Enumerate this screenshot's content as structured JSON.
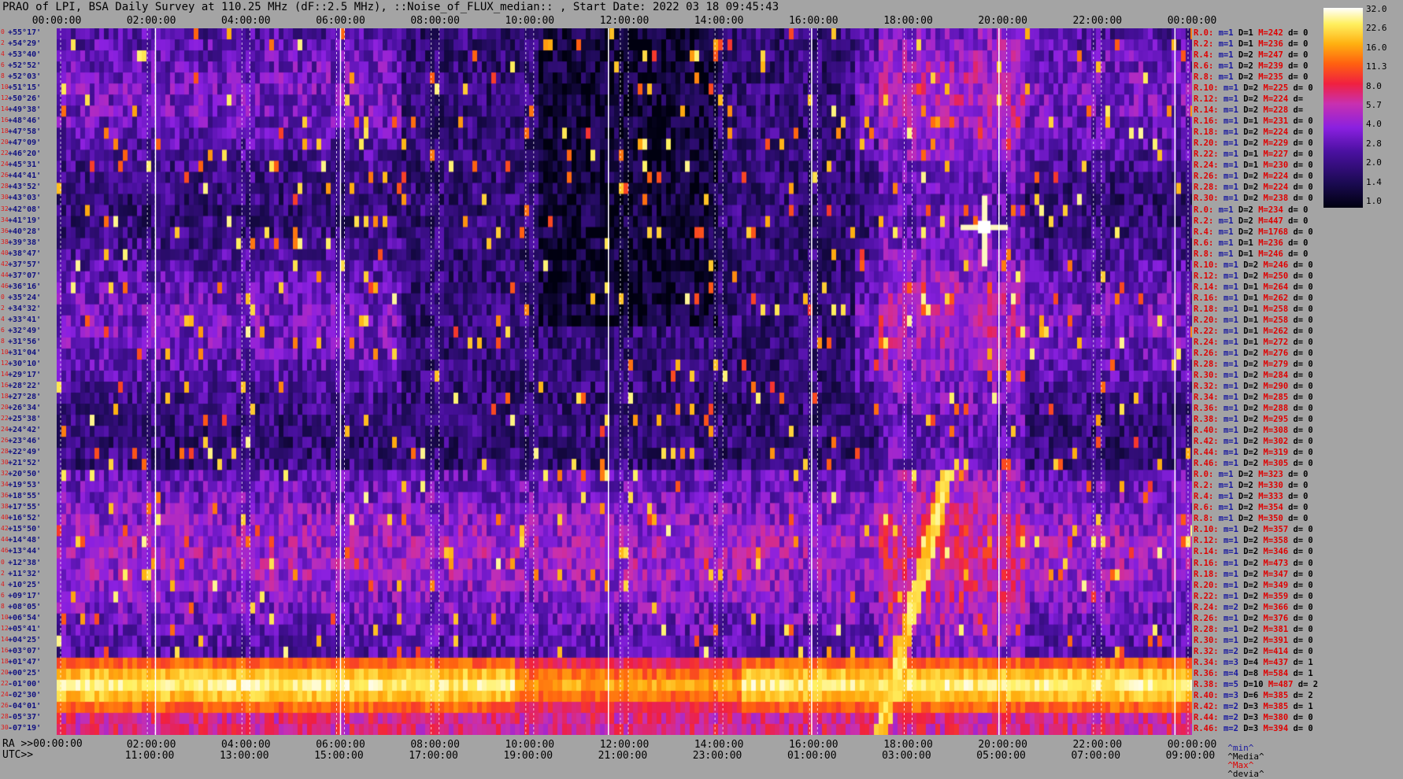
{
  "title": "PRAO of LPI, BSA Daily Survey at 110.25 MHz (dF::2.5 MHz), ::Noise_of_FLUX_median:: , Start Date: 2022 03 18 09:45:43",
  "top_ticks": [
    "00:00:00",
    "02:00:00",
    "04:00:00",
    "06:00:00",
    "08:00:00",
    "10:00:00",
    "12:00:00",
    "14:00:00",
    "16:00:00",
    "18:00:00",
    "20:00:00",
    "22:00:00",
    "00:00:00"
  ],
  "ra_label": "RA >>00:00:00",
  "ra_ticks": [
    "02:00:00",
    "04:00:00",
    "06:00:00",
    "08:00:00",
    "10:00:00",
    "12:00:00",
    "14:00:00",
    "16:00:00",
    "18:00:00",
    "20:00:00",
    "22:00:00",
    "00:00:00"
  ],
  "utc_label": "UTC>>",
  "utc_ticks": [
    "11:00:00",
    "13:00:00",
    "15:00:00",
    "17:00:00",
    "19:00:00",
    "21:00:00",
    "23:00:00",
    "01:00:00",
    "03:00:00",
    "05:00:00",
    "07:00:00",
    "09:00:00"
  ],
  "beam_numbers": [
    "0",
    "2",
    "4",
    "6",
    "8",
    "10",
    "12",
    "14",
    "16",
    "18",
    "20",
    "22",
    "24",
    "26",
    "28",
    "30",
    "32",
    "34",
    "36",
    "38",
    "40",
    "42",
    "44",
    "46",
    "0",
    "2",
    "4",
    "6",
    "8",
    "10",
    "12",
    "14",
    "16",
    "18",
    "20",
    "22",
    "24",
    "26",
    "28",
    "30",
    "32",
    "34",
    "36",
    "38",
    "40",
    "42",
    "44",
    "46",
    "0",
    "2",
    "4",
    "6",
    "8",
    "10",
    "12",
    "14",
    "16",
    "18",
    "20",
    "22",
    "24",
    "26",
    "28",
    "30",
    "32",
    "34",
    "36",
    "38",
    "40",
    "42",
    "44",
    "46"
  ],
  "declinations": [
    "+55°17'",
    "+54°29'",
    "+53°40'",
    "+52°52'",
    "+52°03'",
    "+51°15'",
    "+50°26'",
    "+49°38'",
    "+48°46'",
    "+47°58'",
    "+47°09'",
    "+46°20'",
    "+45°31'",
    "+44°41'",
    "+43°52'",
    "+43°03'",
    "+42°08'",
    "+41°19'",
    "+40°28'",
    "+39°38'",
    "+38°47'",
    "+37°57'",
    "+37°07'",
    "+36°16'",
    "+35°24'",
    "+34°32'",
    "+33°41'",
    "+32°49'",
    "+31°56'",
    "+31°04'",
    "+30°10'",
    "+29°17'",
    "+28°22'",
    "+27°28'",
    "+26°34'",
    "+25°38'",
    "+24°42'",
    "+23°46'",
    "+22°49'",
    "+21°52'",
    "+20°50'",
    "+19°53'",
    "+18°55'",
    "+17°55'",
    "+16°52'",
    "+15°50'",
    "+14°48'",
    "+13°44'",
    "+12°38'",
    "+11°32'",
    "+10°25'",
    "+09°17'",
    "+08°05'",
    "+06°54'",
    "+05°41'",
    "+04°25'",
    "+03°07'",
    "+01°47'",
    "+00°25'",
    "-01°00'",
    "-02°30'",
    "-04°01'",
    "-05°37'",
    "-07°19'"
  ],
  "stats": [
    {
      "r": "R.0:",
      "m": "m=1",
      "D": "D=1",
      "M": "M=242",
      "d": "d= 0"
    },
    {
      "r": "R.2:",
      "m": "m=1",
      "D": "D=1",
      "M": "M=236",
      "d": "d= 0"
    },
    {
      "r": "R.4:",
      "m": "m=1",
      "D": "D=2",
      "M": "M=247",
      "d": "d= 0"
    },
    {
      "r": "R.6:",
      "m": "m=1",
      "D": "D=2",
      "M": "M=239",
      "d": "d= 0"
    },
    {
      "r": "R.8:",
      "m": "m=1",
      "D": "D=2",
      "M": "M=235",
      "d": "d= 0"
    },
    {
      "r": "R.10:",
      "m": "m=1",
      "D": "D=2",
      "M": "M=225",
      "d": "d= 0"
    },
    {
      "r": "R.12:",
      "m": "m=1",
      "D": "D=2",
      "M": "M=224",
      "d": "d="
    },
    {
      "r": "R.14:",
      "m": "m=1",
      "D": "D=2",
      "M": "M=228",
      "d": "d="
    },
    {
      "r": "R.16:",
      "m": "m=1",
      "D": "D=1",
      "M": "M=231",
      "d": "d= 0"
    },
    {
      "r": "R.18:",
      "m": "m=1",
      "D": "D=2",
      "M": "M=224",
      "d": "d= 0"
    },
    {
      "r": "R.20:",
      "m": "m=1",
      "D": "D=2",
      "M": "M=229",
      "d": "d= 0"
    },
    {
      "r": "R.22:",
      "m": "m=1",
      "D": "D=1",
      "M": "M=227",
      "d": "d= 0"
    },
    {
      "r": "R.24:",
      "m": "m=1",
      "D": "D=1",
      "M": "M=230",
      "d": "d= 0"
    },
    {
      "r": "R.26:",
      "m": "m=1",
      "D": "D=2",
      "M": "M=224",
      "d": "d= 0"
    },
    {
      "r": "R.28:",
      "m": "m=1",
      "D": "D=2",
      "M": "M=224",
      "d": "d= 0"
    },
    {
      "r": "R.30:",
      "m": "m=1",
      "D": "D=2",
      "M": "M=238",
      "d": "d= 0"
    },
    {
      "r": "R.0:",
      "m": "m=1",
      "D": "D=2",
      "M": "M=234",
      "d": "d= 0"
    },
    {
      "r": "R.2:",
      "m": "m=1",
      "D": "D=2",
      "M": "M=447",
      "d": "d= 0"
    },
    {
      "r": "R.4:",
      "m": "m=1",
      "D": "D=2",
      "M": "M=1768",
      "d": "d= 0"
    },
    {
      "r": "R.6:",
      "m": "m=1",
      "D": "D=1",
      "M": "M=236",
      "d": "d= 0"
    },
    {
      "r": "R.8:",
      "m": "m=1",
      "D": "D=1",
      "M": "M=246",
      "d": "d= 0"
    },
    {
      "r": "R.10:",
      "m": "m=1",
      "D": "D=2",
      "M": "M=246",
      "d": "d= 0"
    },
    {
      "r": "R.12:",
      "m": "m=1",
      "D": "D=2",
      "M": "M=250",
      "d": "d= 0"
    },
    {
      "r": "R.14:",
      "m": "m=1",
      "D": "D=1",
      "M": "M=264",
      "d": "d= 0"
    },
    {
      "r": "R.16:",
      "m": "m=1",
      "D": "D=1",
      "M": "M=262",
      "d": "d= 0"
    },
    {
      "r": "R.18:",
      "m": "m=1",
      "D": "D=1",
      "M": "M=258",
      "d": "d= 0"
    },
    {
      "r": "R.20:",
      "m": "m=1",
      "D": "D=1",
      "M": "M=258",
      "d": "d= 0"
    },
    {
      "r": "R.22:",
      "m": "m=1",
      "D": "D=1",
      "M": "M=262",
      "d": "d= 0"
    },
    {
      "r": "R.24:",
      "m": "m=1",
      "D": "D=1",
      "M": "M=272",
      "d": "d= 0"
    },
    {
      "r": "R.26:",
      "m": "m=1",
      "D": "D=2",
      "M": "M=276",
      "d": "d= 0"
    },
    {
      "r": "R.28:",
      "m": "m=1",
      "D": "D=2",
      "M": "M=279",
      "d": "d= 0"
    },
    {
      "r": "R.30:",
      "m": "m=1",
      "D": "D=2",
      "M": "M=284",
      "d": "d= 0"
    },
    {
      "r": "R.32:",
      "m": "m=1",
      "D": "D=2",
      "M": "M=290",
      "d": "d= 0"
    },
    {
      "r": "R.34:",
      "m": "m=1",
      "D": "D=2",
      "M": "M=285",
      "d": "d= 0"
    },
    {
      "r": "R.36:",
      "m": "m=1",
      "D": "D=2",
      "M": "M=288",
      "d": "d= 0"
    },
    {
      "r": "R.38:",
      "m": "m=1",
      "D": "D=2",
      "M": "M=295",
      "d": "d= 0"
    },
    {
      "r": "R.40:",
      "m": "m=1",
      "D": "D=2",
      "M": "M=308",
      "d": "d= 0"
    },
    {
      "r": "R.42:",
      "m": "m=1",
      "D": "D=2",
      "M": "M=302",
      "d": "d= 0"
    },
    {
      "r": "R.44:",
      "m": "m=1",
      "D": "D=2",
      "M": "M=319",
      "d": "d= 0"
    },
    {
      "r": "R.46:",
      "m": "m=1",
      "D": "D=2",
      "M": "M=305",
      "d": "d= 0"
    },
    {
      "r": "R.0:",
      "m": "m=1",
      "D": "D=2",
      "M": "M=323",
      "d": "d= 0"
    },
    {
      "r": "R.2:",
      "m": "m=1",
      "D": "D=2",
      "M": "M=330",
      "d": "d= 0"
    },
    {
      "r": "R.4:",
      "m": "m=1",
      "D": "D=2",
      "M": "M=333",
      "d": "d= 0"
    },
    {
      "r": "R.6:",
      "m": "m=1",
      "D": "D=2",
      "M": "M=354",
      "d": "d= 0"
    },
    {
      "r": "R.8:",
      "m": "m=1",
      "D": "D=2",
      "M": "M=350",
      "d": "d= 0"
    },
    {
      "r": "R.10:",
      "m": "m=1",
      "D": "D=2",
      "M": "M=357",
      "d": "d= 0"
    },
    {
      "r": "R.12:",
      "m": "m=1",
      "D": "D=2",
      "M": "M=358",
      "d": "d= 0"
    },
    {
      "r": "R.14:",
      "m": "m=1",
      "D": "D=2",
      "M": "M=346",
      "d": "d= 0"
    },
    {
      "r": "R.16:",
      "m": "m=1",
      "D": "D=2",
      "M": "M=473",
      "d": "d= 0"
    },
    {
      "r": "R.18:",
      "m": "m=1",
      "D": "D=2",
      "M": "M=347",
      "d": "d= 0"
    },
    {
      "r": "R.20:",
      "m": "m=1",
      "D": "D=2",
      "M": "M=349",
      "d": "d= 0"
    },
    {
      "r": "R.22:",
      "m": "m=1",
      "D": "D=2",
      "M": "M=359",
      "d": "d= 0"
    },
    {
      "r": "R.24:",
      "m": "m=2",
      "D": "D=2",
      "M": "M=366",
      "d": "d= 0"
    },
    {
      "r": "R.26:",
      "m": "m=1",
      "D": "D=2",
      "M": "M=376",
      "d": "d= 0"
    },
    {
      "r": "R.28:",
      "m": "m=1",
      "D": "D=2",
      "M": "M=381",
      "d": "d= 0"
    },
    {
      "r": "R.30:",
      "m": "m=1",
      "D": "D=2",
      "M": "M=391",
      "d": "d= 0"
    },
    {
      "r": "R.32:",
      "m": "m=2",
      "D": "D=2",
      "M": "M=414",
      "d": "d= 0"
    },
    {
      "r": "R.34:",
      "m": "m=3",
      "D": "D=4",
      "M": "M=437",
      "d": "d= 1"
    },
    {
      "r": "R.36:",
      "m": "m=4",
      "D": "D=8",
      "M": "M=584",
      "d": "d= 1"
    },
    {
      "r": "R.38:",
      "m": "m=5",
      "D": "D=10",
      "M": "M=487",
      "d": "d= 2"
    },
    {
      "r": "R.40:",
      "m": "m=3",
      "D": "D=6",
      "M": "M=385",
      "d": "d= 2"
    },
    {
      "r": "R.42:",
      "m": "m=2",
      "D": "D=3",
      "M": "M=385",
      "d": "d= 1"
    },
    {
      "r": "R.44:",
      "m": "m=2",
      "D": "D=3",
      "M": "M=380",
      "d": "d= 0"
    },
    {
      "r": "R.46:",
      "m": "m=2",
      "D": "D=3",
      "M": "M=394",
      "d": "d= 0"
    }
  ],
  "footer": {
    "min": "^min^",
    "media": "^Media^",
    "max": "^Max^",
    "devia": "^devia^"
  },
  "colorbar_ticks": [
    "32.0",
    "22.6",
    "16.0",
    "11.3",
    "8.0",
    "5.7",
    "4.0",
    "2.8",
    "2.0",
    "1.4",
    "1.0"
  ],
  "colors": {
    "background": "#a4a4a4",
    "stat_red": "#e00000",
    "stat_blue": "#1818a0"
  },
  "chart_data": {
    "type": "heatmap",
    "title": "PRAO of LPI, BSA Daily Survey at 110.25 MHz (dF::2.5 MHz), ::Noise_of_FLUX_median:: , Start Date: 2022 03 18 09:45:43",
    "x_axis_ra": [
      "00:00:00",
      "02:00:00",
      "04:00:00",
      "06:00:00",
      "08:00:00",
      "10:00:00",
      "12:00:00",
      "14:00:00",
      "16:00:00",
      "18:00:00",
      "20:00:00",
      "22:00:00",
      "00:00:00"
    ],
    "x_axis_utc": [
      "11:00:00",
      "13:00:00",
      "15:00:00",
      "17:00:00",
      "19:00:00",
      "21:00:00",
      "23:00:00",
      "01:00:00",
      "03:00:00",
      "05:00:00",
      "07:00:00",
      "09:00:00"
    ],
    "y_range_dec": [
      "+55°17'",
      "-07°19'"
    ],
    "rows": 64,
    "colorscale": "log",
    "colorbar_range": [
      1.0,
      32.0
    ],
    "colorbar_ticks": [
      32.0,
      22.6,
      16.0,
      11.3,
      8.0,
      5.7,
      4.0,
      2.8,
      2.0,
      1.4,
      1.0
    ],
    "features": [
      {
        "type": "bright_band",
        "dec_from": "+01°47'",
        "dec_to": "-02°30'",
        "level": "high"
      },
      {
        "type": "point_source",
        "ra": "19:55:00",
        "dec": "+40°28'",
        "level": "max"
      },
      {
        "type": "diagonal_streak",
        "ra_from": "17:00:00",
        "ra_to": "20:00:00",
        "dec_from": "-07°19'",
        "dec_to": "+20°50'"
      }
    ]
  }
}
